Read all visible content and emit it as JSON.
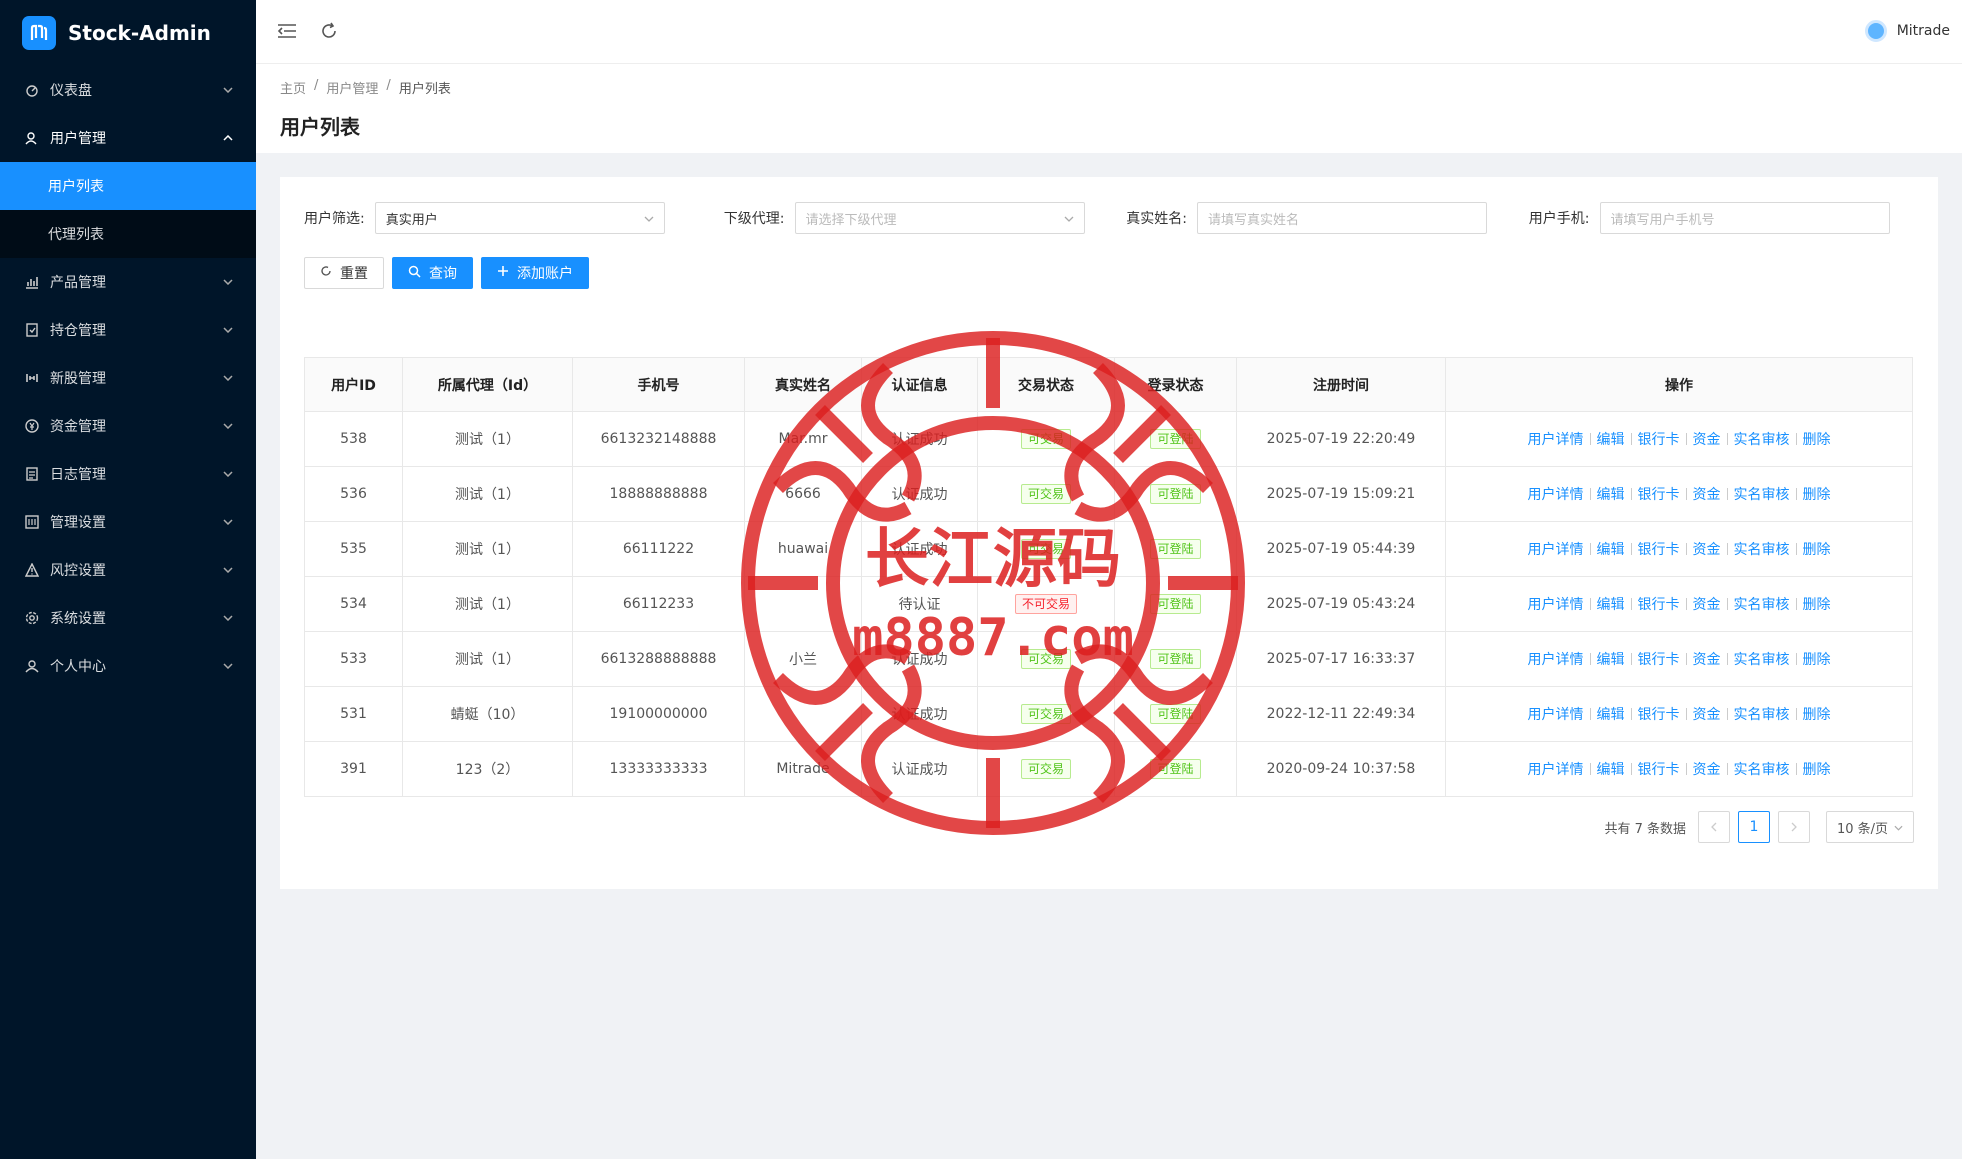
{
  "app": {
    "name": "Stock-Admin"
  },
  "sidebar": {
    "items": [
      {
        "label": "仪表盘",
        "icon": "dashboard-icon"
      },
      {
        "label": "用户管理",
        "icon": "user-manage-icon"
      },
      {
        "label": "产品管理",
        "icon": "product-icon"
      },
      {
        "label": "持仓管理",
        "icon": "position-icon"
      },
      {
        "label": "新股管理",
        "icon": "ipo-icon"
      },
      {
        "label": "资金管理",
        "icon": "fund-icon"
      },
      {
        "label": "日志管理",
        "icon": "log-icon"
      },
      {
        "label": "管理设置",
        "icon": "admin-settings-icon"
      },
      {
        "label": "风控设置",
        "icon": "risk-icon"
      },
      {
        "label": "系统设置",
        "icon": "system-settings-icon"
      },
      {
        "label": "个人中心",
        "icon": "profile-icon"
      }
    ],
    "sub_items": [
      {
        "label": "用户列表",
        "active": true
      },
      {
        "label": "代理列表",
        "active": false
      }
    ]
  },
  "header": {
    "username": "Mitrade"
  },
  "breadcrumb": [
    "主页",
    "用户管理",
    "用户列表"
  ],
  "page_title": "用户列表",
  "filters": {
    "user_filter": {
      "label": "用户筛选:",
      "value": "真实用户"
    },
    "agent": {
      "label": "下级代理:",
      "placeholder": "请选择下级代理"
    },
    "real_name": {
      "label": "真实姓名:",
      "placeholder": "请填写真实姓名"
    },
    "phone": {
      "label": "用户手机:",
      "placeholder": "请填写用户手机号"
    }
  },
  "buttons": {
    "reset": "重置",
    "query": "查询",
    "add": "添加账户"
  },
  "table": {
    "columns": [
      "用户ID",
      "所属代理（Id）",
      "手机号",
      "真实姓名",
      "认证信息",
      "交易状态",
      "登录状态",
      "注册时间",
      "操作"
    ],
    "rows": [
      {
        "id": "538",
        "agent": "测试（1）",
        "phone": "6613232148888",
        "name": "Mar.mr",
        "auth": "认证成功",
        "trade": "可交易",
        "trade_ok": true,
        "login": "可登陆",
        "time": "2025-07-19 22:20:49"
      },
      {
        "id": "536",
        "agent": "测试（1）",
        "phone": "18888888888",
        "name": "6666",
        "auth": "认证成功",
        "trade": "可交易",
        "trade_ok": true,
        "login": "可登陆",
        "time": "2025-07-19 15:09:21"
      },
      {
        "id": "535",
        "agent": "测试（1）",
        "phone": "66111222",
        "name": "huawai",
        "auth": "认证成功",
        "trade": "可交易",
        "trade_ok": true,
        "login": "可登陆",
        "time": "2025-07-19 05:44:39"
      },
      {
        "id": "534",
        "agent": "测试（1）",
        "phone": "66112233",
        "name": "",
        "auth": "待认证",
        "trade": "不可交易",
        "trade_ok": false,
        "login": "可登陆",
        "time": "2025-07-19 05:43:24"
      },
      {
        "id": "533",
        "agent": "测试（1）",
        "phone": "6613288888888",
        "name": "小兰",
        "auth": "认证成功",
        "trade": "可交易",
        "trade_ok": true,
        "login": "可登陆",
        "time": "2025-07-17 16:33:37"
      },
      {
        "id": "531",
        "agent": "蜻蜓（10）",
        "phone": "19100000000",
        "name": "",
        "auth": "认证成功",
        "trade": "可交易",
        "trade_ok": true,
        "login": "可登陆",
        "time": "2022-12-11 22:49:34"
      },
      {
        "id": "391",
        "agent": "123（2）",
        "phone": "13333333333",
        "name": "Mitrade",
        "auth": "认证成功",
        "trade": "可交易",
        "trade_ok": true,
        "login": "可登陆",
        "time": "2020-09-24 10:37:58"
      }
    ],
    "actions": [
      "用户详情",
      "编辑",
      "银行卡",
      "资金",
      "实名审核",
      "删除"
    ]
  },
  "pagination": {
    "total_text": "共有 7 条数据",
    "current": "1",
    "page_size": "10 条/页"
  },
  "watermark": {
    "line1": "长江源码",
    "line2": "m8887.com"
  },
  "colors": {
    "sidebar_bg": "#001529",
    "primary": "#1890ff",
    "success": "#52c41a",
    "danger": "#f5222d"
  }
}
